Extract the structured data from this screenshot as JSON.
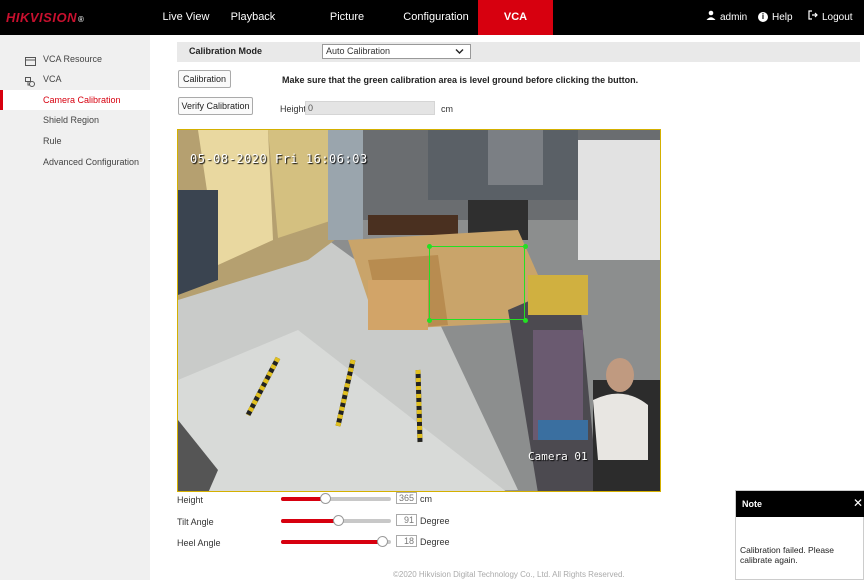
{
  "brand": {
    "name": "HIKVISION",
    "mark": "®"
  },
  "topnav": {
    "tabs": [
      {
        "label": "Live View"
      },
      {
        "label": "Playback"
      },
      {
        "label": "Picture"
      },
      {
        "label": "Configuration"
      },
      {
        "label": "VCA"
      }
    ],
    "active_tab": "VCA",
    "user": "admin",
    "help": "Help",
    "logout": "Logout"
  },
  "sidebar": {
    "items": [
      {
        "label": "VCA Resource",
        "icon": "monitor-icon"
      },
      {
        "label": "VCA",
        "icon": "vca-icon"
      },
      {
        "label": "Camera Calibration"
      },
      {
        "label": "Shield Region"
      },
      {
        "label": "Rule"
      },
      {
        "label": "Advanced Configuration"
      }
    ],
    "active_item": "Camera Calibration"
  },
  "calibration": {
    "mode_label": "Calibration Mode",
    "mode_value": "Auto Calibration",
    "calibration_button": "Calibration",
    "hint": "Make sure that the green calibration area is level ground before clicking the button.",
    "verify_button": "Verify Calibration",
    "height_label": "Height",
    "height_value": "0",
    "height_unit": "cm"
  },
  "camera": {
    "osd_time": "05-08-2020 Fri 16:06:03",
    "osd_name": "Camera 01"
  },
  "sliders": {
    "height": {
      "label": "Height",
      "value": "365",
      "unit": "cm",
      "level": 0.4
    },
    "tilt": {
      "label": "Tilt Angle",
      "value": "91",
      "unit": "Degree",
      "level": 0.52
    },
    "heel": {
      "label": "Heel Angle",
      "value": "18",
      "unit": "Degree",
      "level": 0.92
    }
  },
  "footer": "©2020 Hikvision Digital Technology Co., Ltd. All Rights Reserved.",
  "note": {
    "title": "Note",
    "message": "Calibration failed. Please calibrate again."
  },
  "colors": {
    "accent": "#d7000f",
    "calibration_box": "#23e023",
    "topbar": "#000000"
  }
}
